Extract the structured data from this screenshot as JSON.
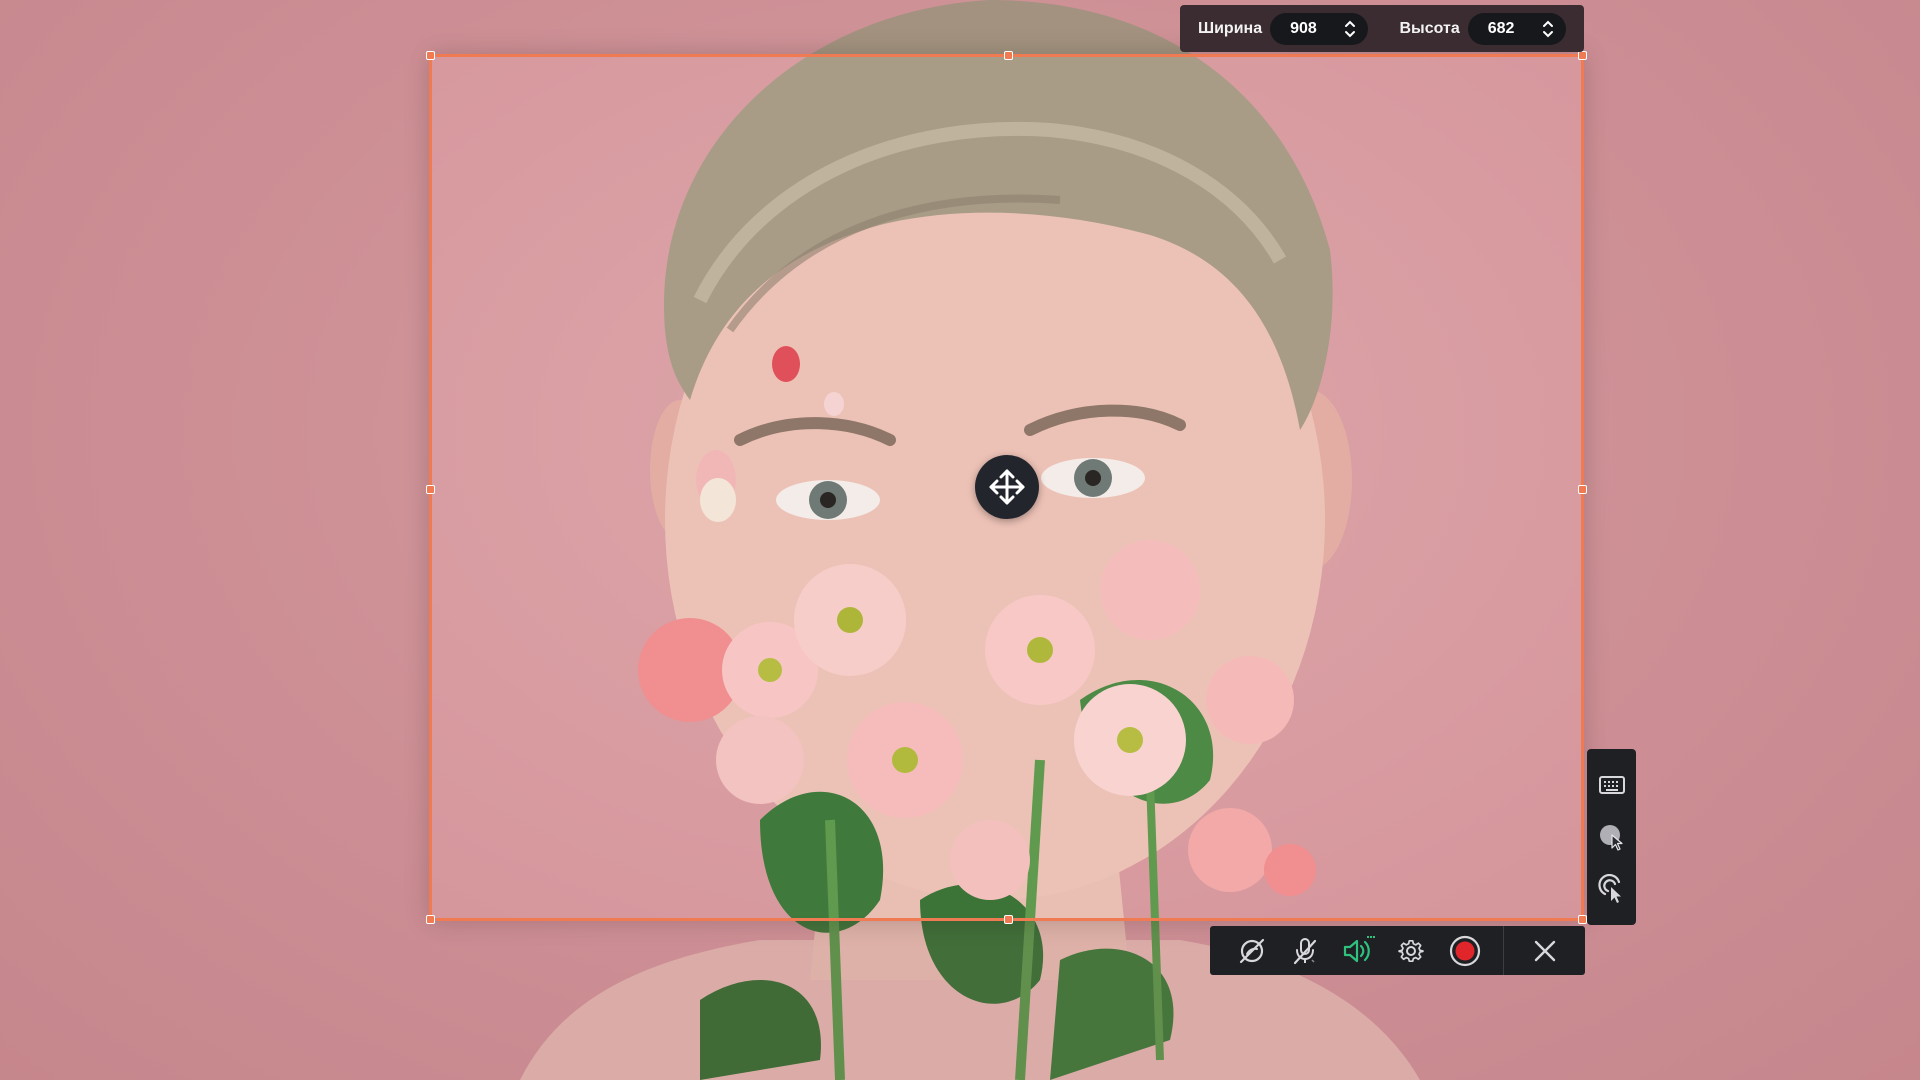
{
  "size_bar": {
    "width_label": "Ширина",
    "width_value": "908",
    "height_label": "Высота",
    "height_value": "682"
  },
  "icons": {
    "move": "move-arrows-icon",
    "stepper": "chevron-up-down-icon",
    "keyboard": "keyboard-icon",
    "cursor_highlight": "cursor-highlight-icon",
    "click_effect": "click-effect-icon",
    "webcam_off": "webcam-off-icon",
    "microphone_off": "microphone-off-icon",
    "system_sound": "speaker-icon",
    "settings": "gear-icon",
    "record": "record-icon",
    "close": "close-icon"
  },
  "colors": {
    "frame": "#f07a52",
    "record": "#e0262b",
    "sound_active": "#2fc27e",
    "toolbar_bg": "#1f2024",
    "background": "#d99aa0"
  }
}
